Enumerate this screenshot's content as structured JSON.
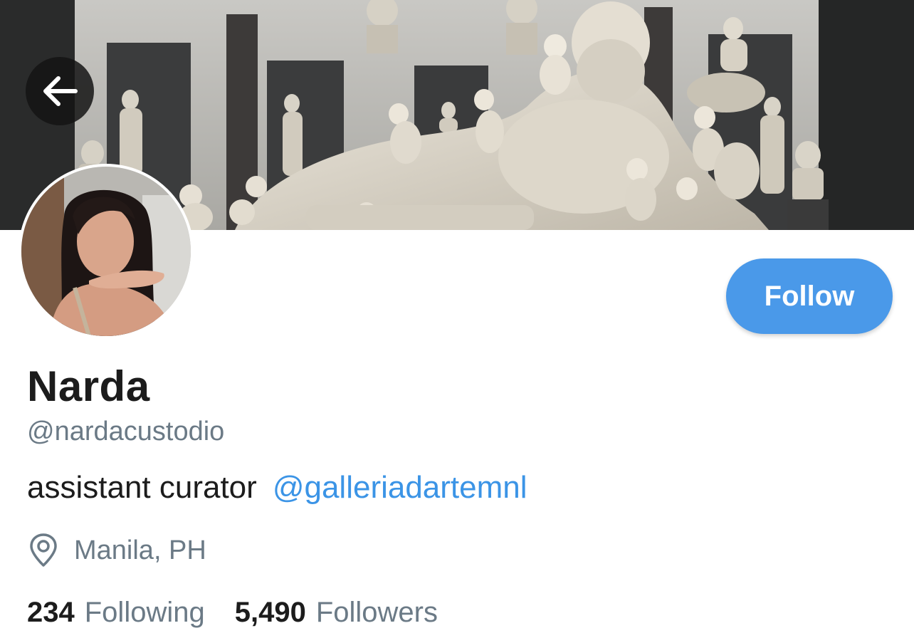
{
  "header": {
    "back_icon": "arrow-left-icon",
    "banner_description_icon": "banner-image"
  },
  "profile": {
    "display_name": "Narda",
    "handle": "@nardacustodio",
    "bio_text": "assistant curator",
    "bio_mention": "@galleriadartemnl",
    "location_icon": "location-pin-icon",
    "location": "Manila, PH"
  },
  "actions": {
    "follow_label": "Follow"
  },
  "stats": {
    "following_count": "234",
    "following_label": "Following",
    "followers_count": "5,490",
    "followers_label": "Followers"
  },
  "colors": {
    "accent": "#4a99e9",
    "link": "#3b94e6",
    "secondary_text": "#6b7a86",
    "primary_text": "#1c1c1c"
  }
}
